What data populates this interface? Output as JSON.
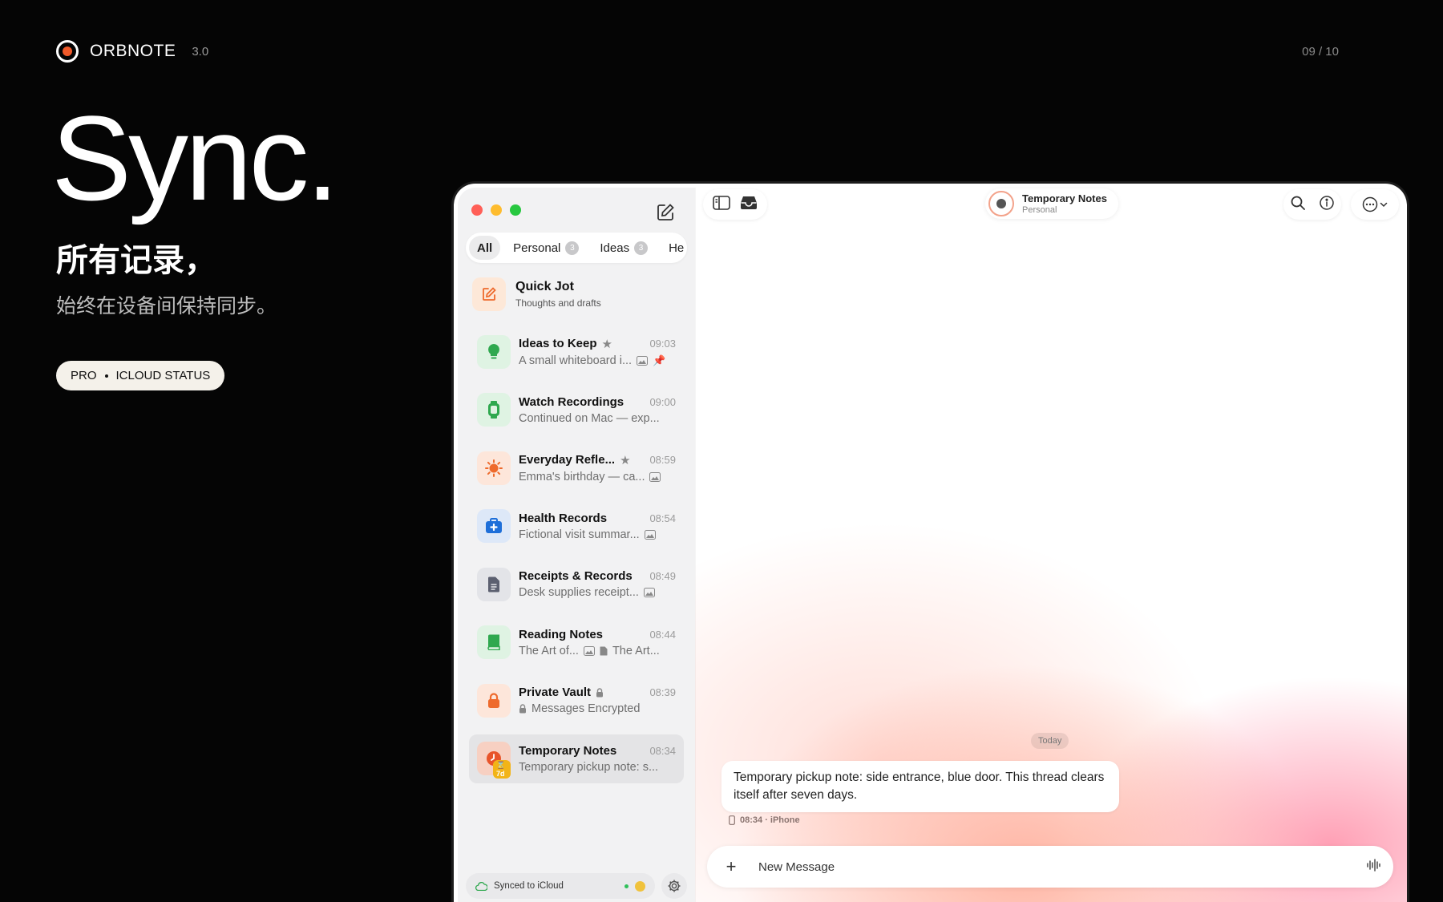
{
  "brand": {
    "name": "ORBNOTE",
    "version": "3.0"
  },
  "page_counter": "09 / 10",
  "hero": {
    "title": "Sync.",
    "subtitle_1": "所有记录，",
    "subtitle_2": "始终在设备间保持同步。",
    "pill_left": "PRO",
    "pill_right": "ICLOUD STATUS"
  },
  "sidebar": {
    "tabs": [
      {
        "label": "All",
        "badge": ""
      },
      {
        "label": "Personal",
        "badge": "3"
      },
      {
        "label": "Ideas",
        "badge": "3"
      },
      {
        "label": "He",
        "badge": ""
      }
    ],
    "quick_jot": {
      "title": "Quick Jot",
      "subtitle": "Thoughts and drafts"
    },
    "notes": [
      {
        "title": "Ideas to Keep",
        "time": "09:03",
        "preview": "A small whiteboard i...",
        "icon": "lightbulb-icon"
      },
      {
        "title": "Watch Recordings",
        "time": "09:00",
        "preview": "Continued on Mac — exp...",
        "icon": "watch-icon"
      },
      {
        "title": "Everyday Refle...",
        "time": "08:59",
        "preview": "Emma's birthday — ca...",
        "icon": "sun-icon"
      },
      {
        "title": "Health Records",
        "time": "08:54",
        "preview": "Fictional visit summar...",
        "icon": "medical-kit-icon"
      },
      {
        "title": "Receipts & Records",
        "time": "08:49",
        "preview": "Desk supplies receipt...",
        "icon": "document-icon"
      },
      {
        "title": "Reading Notes",
        "time": "08:44",
        "preview": "The Art of...",
        "preview_2": "The Art...",
        "icon": "book-icon"
      },
      {
        "title": "Private Vault",
        "time": "08:39",
        "preview": "Messages Encrypted",
        "icon": "lock-icon"
      },
      {
        "title": "Temporary Notes",
        "time": "08:34",
        "preview": "Temporary pickup note: s...",
        "icon": "timer-icon",
        "badge": "⌛7d"
      }
    ],
    "sync_status": "Synced to iCloud"
  },
  "chat": {
    "title": "Temporary Notes",
    "subtitle": "Personal",
    "day_label": "Today",
    "message": "Temporary pickup note: side entrance, blue door. This thread clears itself after seven days.",
    "message_meta": "08:34 · iPhone",
    "composer_placeholder": "New Message"
  },
  "colors": {
    "accent_orange": "#f05a2a",
    "green_icon": "#2fa84f",
    "blue_icon": "#1e6fd9",
    "gray_icon": "#5c6070",
    "orange_icon": "#ee6a2c"
  }
}
